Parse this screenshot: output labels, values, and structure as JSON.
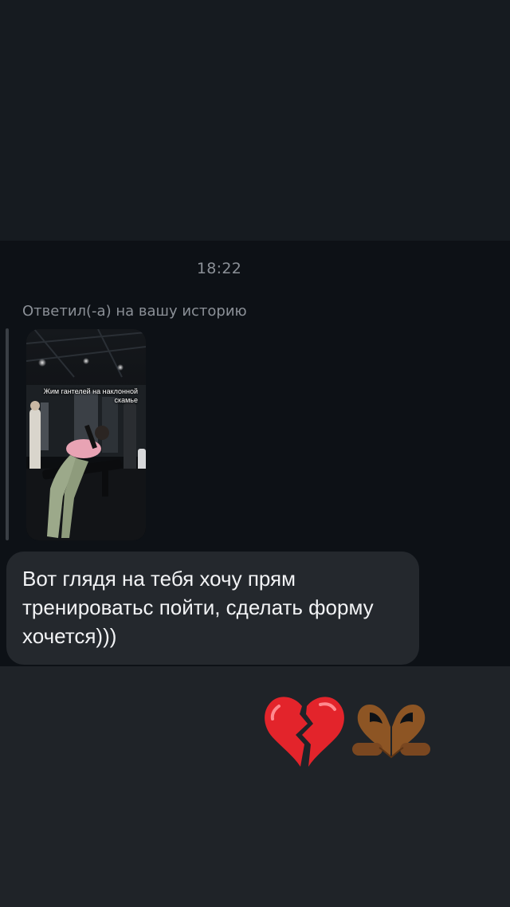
{
  "chat": {
    "timestamp": "18:22",
    "reply_label": "Ответил(-а) на вашу историю",
    "story": {
      "caption": "Жим гантелей на наклонной скамье"
    },
    "message": {
      "text": "Вот глядя на тебя хочу прям тренироватьс пойти, сделать форму хочется)))"
    },
    "reactions": [
      {
        "icon": "broken-heart-icon",
        "color": "#e3242b"
      },
      {
        "icon": "heart-hands-icon",
        "color": "#8d5524"
      }
    ]
  }
}
